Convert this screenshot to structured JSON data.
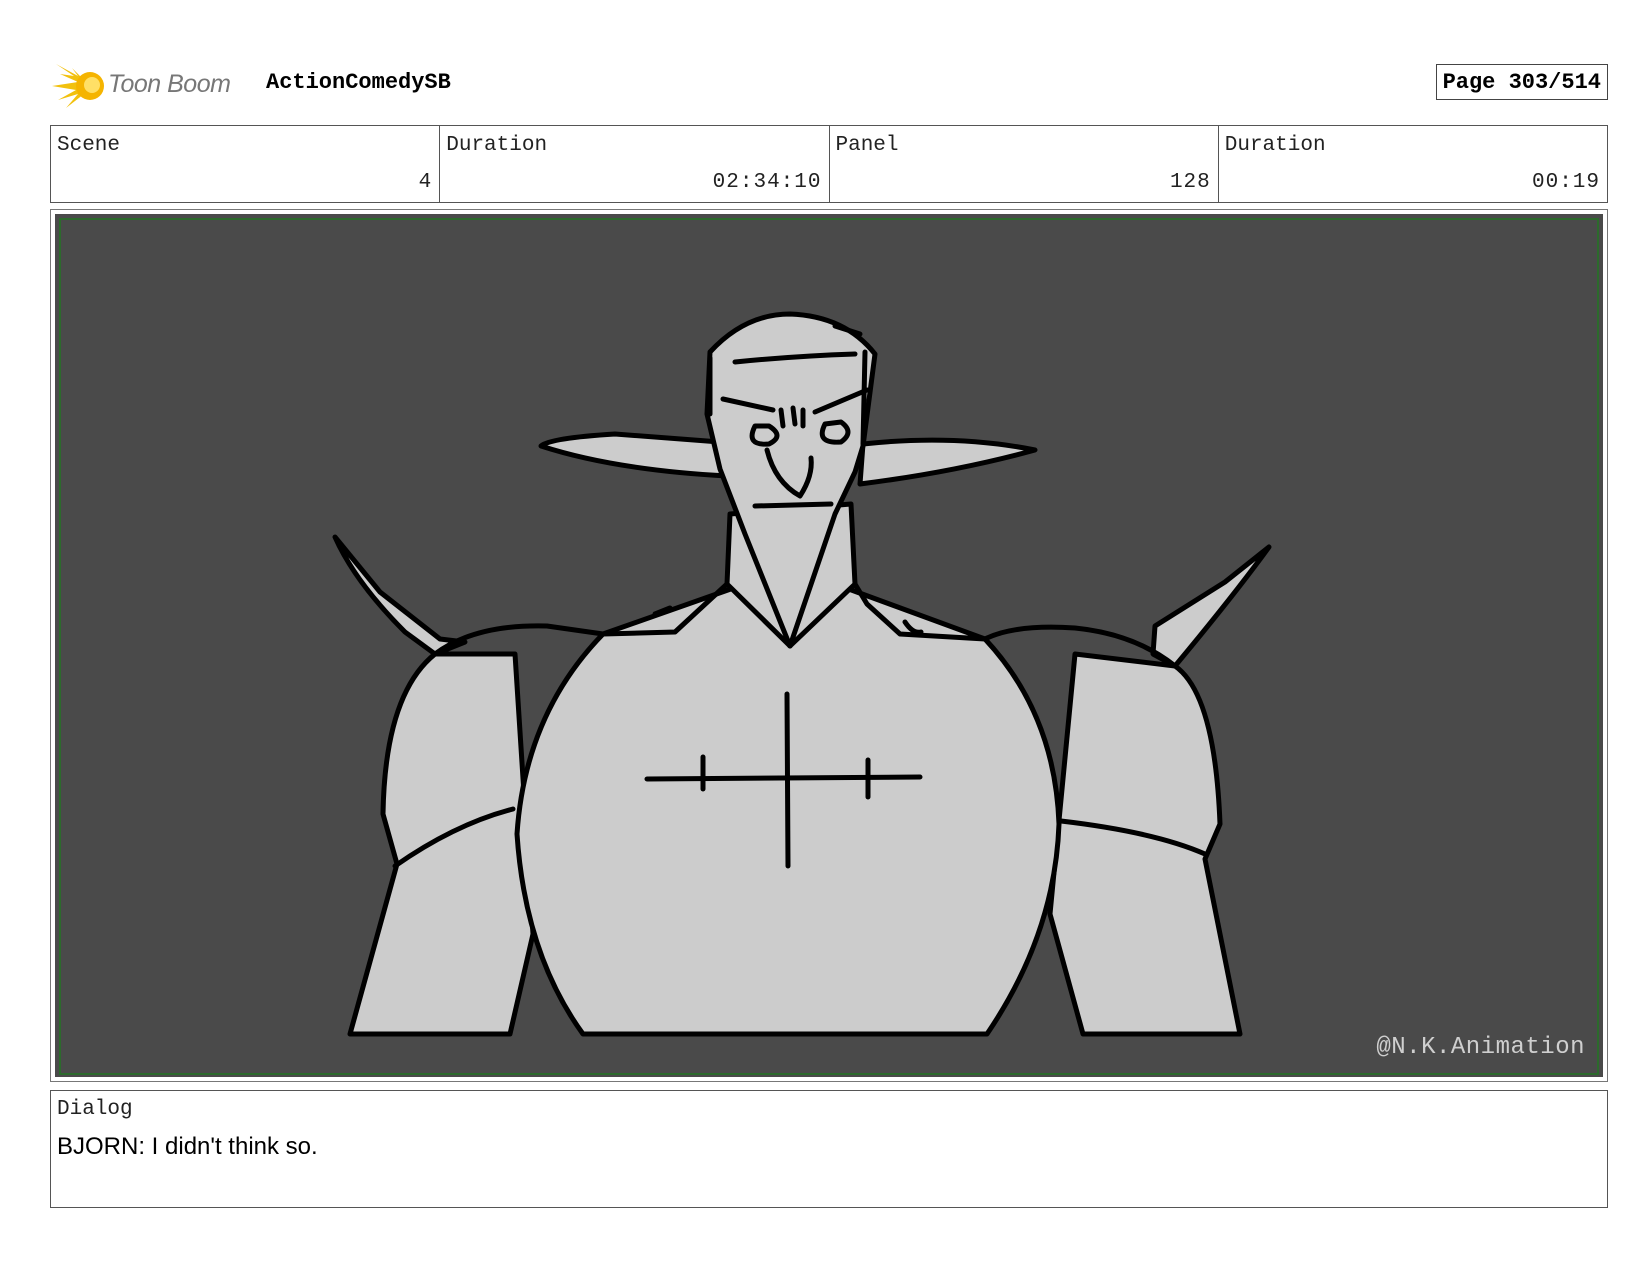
{
  "header": {
    "logo_text": "Toon Boom",
    "project_title": "ActionComedySB",
    "page_label": "Page 303/514"
  },
  "info": {
    "scene_label": "Scene",
    "scene_value": "4",
    "scene_duration_label": "Duration",
    "scene_duration_value": "02:34:10",
    "panel_label": "Panel",
    "panel_value": "128",
    "panel_duration_label": "Duration",
    "panel_duration_value": "00:19"
  },
  "panel": {
    "watermark": "@N.K.Animation",
    "background_color": "#4a4a4a",
    "figure_color": "#cccccc",
    "safe_frame_color": "#2c6a2c"
  },
  "dialog": {
    "label": "Dialog",
    "text": "BJORN: I didn't think so."
  }
}
